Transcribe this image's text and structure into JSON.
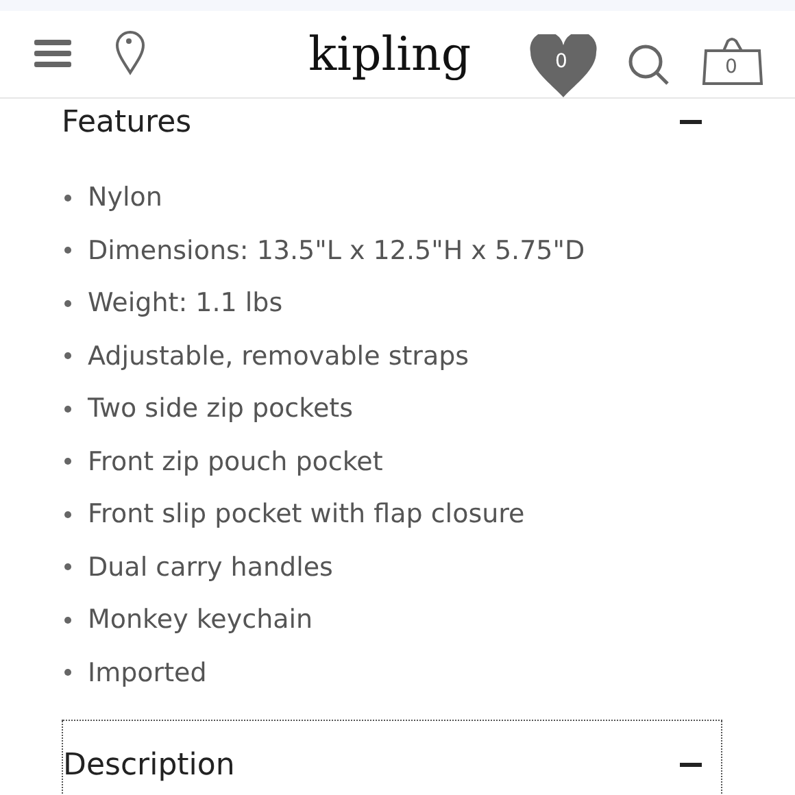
{
  "header": {
    "logo": "kipling",
    "wishlist_count": "0",
    "cart_count": "0"
  },
  "sections": [
    {
      "title": "Features",
      "expanded": true,
      "focused": false,
      "items": [
        "Nylon",
        "Dimensions: 13.5\"L x 12.5\"H x 5.75\"D",
        "Weight: 1.1 lbs",
        "Adjustable, removable straps",
        "Two side zip pockets",
        "Front zip pouch pocket",
        "Front slip pocket with flap closure",
        "Dual carry handles",
        "Monkey keychain",
        "Imported"
      ]
    },
    {
      "title": "Description",
      "expanded": true,
      "focused": true
    }
  ]
}
